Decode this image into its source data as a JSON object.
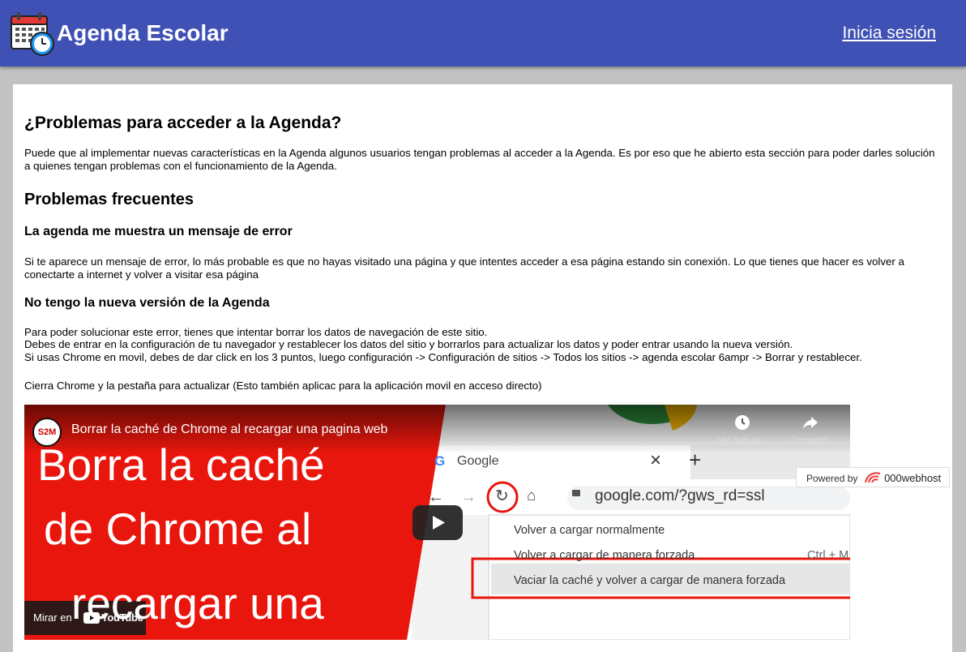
{
  "header": {
    "title": "Agenda Escolar",
    "login_link": "Inicia sesión",
    "background": "#3f51b5"
  },
  "main": {
    "heading": "¿Problemas para acceder a la Agenda?",
    "intro": "Puede que al implementar nuevas características en la Agenda algunos usuarios tengan problemas al acceder a la Agenda. Es por eso que he abierto esta sección para poder darles solución a quienes tengan problemas con el funcionamiento de la Agenda.",
    "section_heading": "Problemas frecuentes",
    "problems": [
      {
        "title": "La agenda me muestra un mensaje de error",
        "lines": [
          "Si te aparece un mensaje de error, lo más probable es que no hayas visitado una página y que intentes acceder a esa página estando sin conexión. Lo que tienes que hacer es volver a conectarte a internet y volver a visitar esa página"
        ]
      },
      {
        "title": "No tengo la nueva versión de la Agenda",
        "lines": [
          "Para poder solucionar este error, tienes que intentar borrar los datos de navegación de este sitio.",
          "Debes de entrar en la configuración de tu navegador y restablecer los datos del sitio y borrarlos para actualizar los datos y poder entrar usando la nueva versión.",
          "Si usas Chrome en movil, debes de dar click en los 3 puntos, luego configuración -> Configuración de sitios -> Todos los sitios -> agenda escolar 6ampr -> Borrar y restablecer.",
          "Cierra Chrome y la pestaña para actualizar (Esto también aplicac para la aplicación movil en acceso directo)"
        ]
      }
    ]
  },
  "video": {
    "channel_badge": "S2M",
    "title": "Borrar la caché de Chrome al recargar una pagina web",
    "thumbnail_lines": [
      "Borra la caché",
      "de Chrome al",
      "recargar una"
    ],
    "watch_later": "Ver más ta...",
    "share": "Compartir",
    "watch_on": "Mirar en",
    "youtube": "YouTube",
    "browser": {
      "tab_label": "Google",
      "tab_close": "×",
      "new_tab": "+",
      "url": "google.com/?gws_rd=ssl",
      "menu_items": [
        "Volver a cargar normalmente",
        "Volver a cargar de manera forzada",
        "Vaciar la caché y volver a cargar de manera forzada"
      ],
      "shortcut": "Ctrl + M"
    },
    "accent": "#e8160c"
  },
  "footer_badge": {
    "powered_by": "Powered by",
    "brand": "000webhost"
  }
}
